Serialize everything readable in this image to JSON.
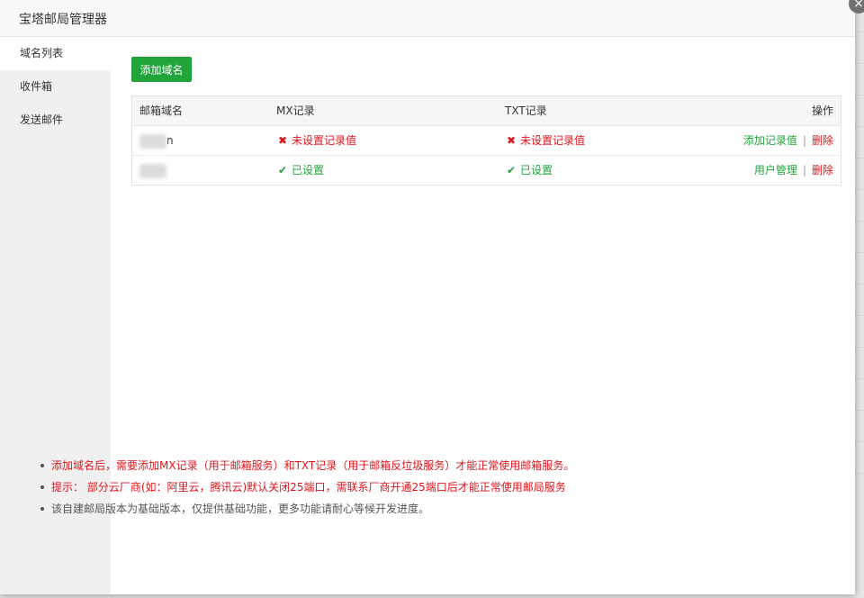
{
  "modal": {
    "title": "宝塔邮局管理器",
    "close_icon": "×"
  },
  "sidebar": {
    "items": [
      {
        "label": "域名列表",
        "active": true
      },
      {
        "label": "收件箱",
        "active": false
      },
      {
        "label": "发送邮件",
        "active": false
      }
    ]
  },
  "toolbar": {
    "add_domain_label": "添加域名"
  },
  "table": {
    "headers": {
      "domain": "邮箱域名",
      "mx": "MX记录",
      "txt": "TXT记录",
      "ops": "操作"
    },
    "rows": [
      {
        "domain_suffix": "n",
        "mx_status": "未设置记录值",
        "mx_ok": false,
        "txt_status": "未设置记录值",
        "txt_ok": false,
        "action_primary": "添加记录值",
        "action_delete": "删除"
      },
      {
        "domain_suffix": "",
        "mx_status": "已设置",
        "mx_ok": true,
        "txt_status": "已设置",
        "txt_ok": true,
        "action_primary": "用户管理",
        "action_delete": "删除"
      }
    ]
  },
  "notes": [
    "添加域名后，需要添加MX记录（用于邮箱服务）和TXT记录（用于邮箱反垃圾服务）才能正常使用邮箱服务。",
    "提示： 部分云厂商(如：阿里云，腾讯云)默认关闭25端口，需联系厂商开通25端口后才能正常使用邮局服务",
    "该自建邮局版本为基础版本，仅提供基础功能，更多功能请耐心等候开发进度。"
  ],
  "colors": {
    "accent": "#20a53a",
    "error": "#e0151c"
  },
  "icons": {
    "error": "✖",
    "ok": "✔"
  }
}
